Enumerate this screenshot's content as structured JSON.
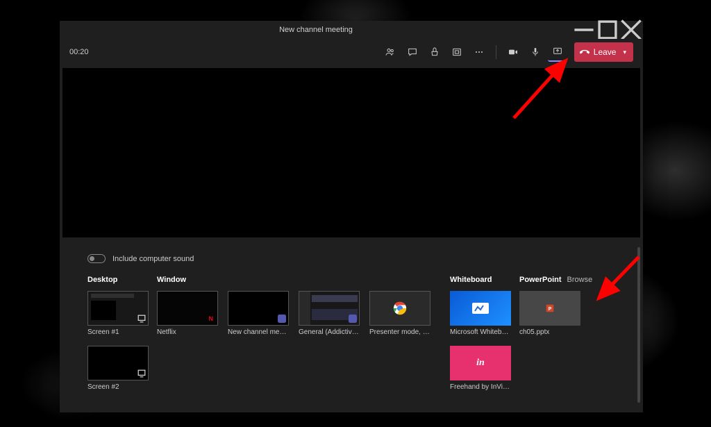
{
  "window": {
    "title": "New channel meeting"
  },
  "toolbar": {
    "timer": "00:20",
    "leave_label": "Leave"
  },
  "share": {
    "sound_label": "Include computer sound",
    "browse_label": "Browse",
    "categories": {
      "desktop": "Desktop",
      "window": "Window",
      "whiteboard": "Whiteboard",
      "powerpoint": "PowerPoint"
    },
    "items": {
      "screen1": "Screen #1",
      "screen2": "Screen #2",
      "netflix": "Netflix",
      "new_channel": "New channel meeting | ...",
      "general": "General (AddictiveTips - ...",
      "presenter": "Presenter mode, notes a...",
      "ms_whiteboard": "Microsoft Whiteboard",
      "freehand": "Freehand by InVision",
      "ppt_file": "ch05.pptx"
    }
  }
}
